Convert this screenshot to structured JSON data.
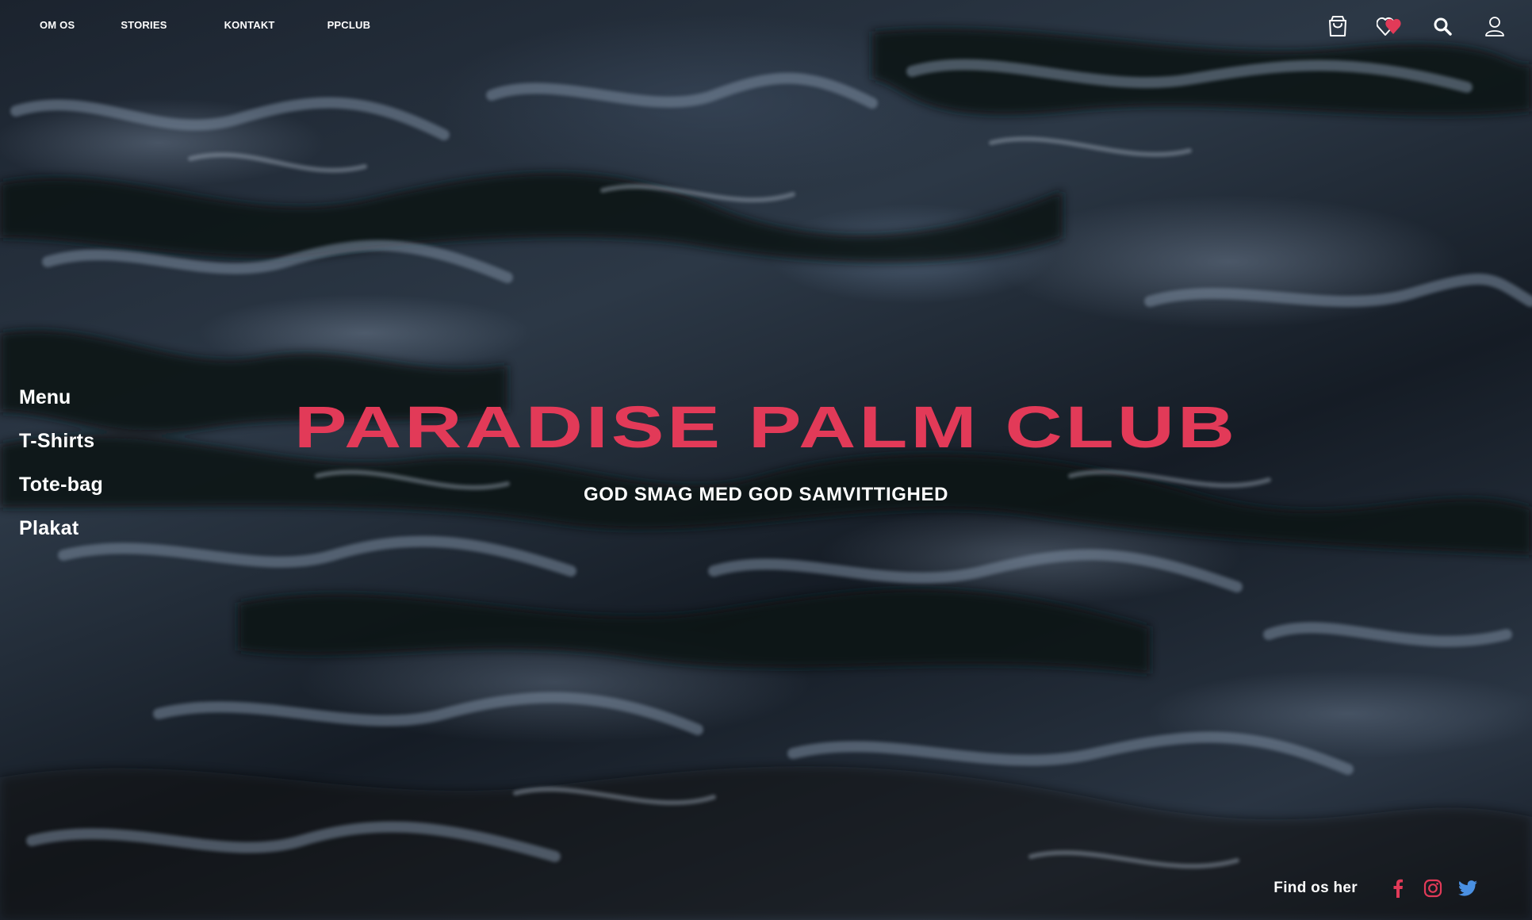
{
  "nav": {
    "items": [
      {
        "label": "OM OS"
      },
      {
        "label": "STORIES"
      },
      {
        "label": "KONTAKT"
      },
      {
        "label": "PPCLUB"
      }
    ]
  },
  "header_icons": {
    "cart": "shopping-bag-icon",
    "wishlist": "heart-icon",
    "search": "search-icon",
    "account": "user-icon"
  },
  "side_menu": {
    "title": "Menu",
    "items": [
      {
        "label": "T-Shirts"
      },
      {
        "label": "Tote-bag"
      },
      {
        "label": "Plakat"
      }
    ]
  },
  "hero": {
    "title": "PARADISE PALM CLUB",
    "subtitle": "GOD SMAG MED GOD SAMVITTIGHED"
  },
  "footer": {
    "find_label": "Find os her",
    "social": [
      {
        "icon": "facebook-icon"
      },
      {
        "icon": "instagram-icon"
      },
      {
        "icon": "twitter-icon"
      }
    ]
  },
  "colors": {
    "accent": "#e23a58",
    "text": "#ffffff",
    "background": "#1b232e",
    "twitter": "#4a90e2"
  }
}
